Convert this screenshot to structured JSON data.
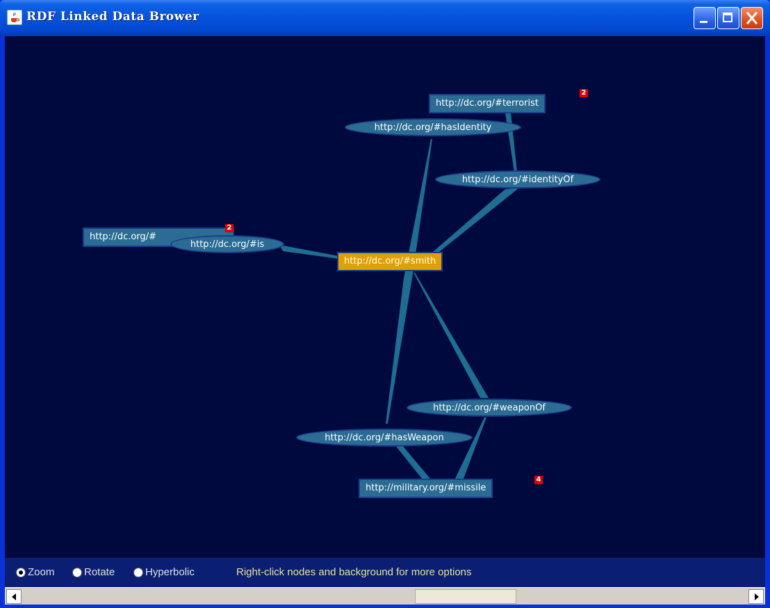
{
  "window": {
    "title": "RDF Linked Data Brower",
    "icons": {
      "app": "java-cup-icon",
      "minimize": "minimize-icon",
      "maximize": "maximize-icon",
      "close": "close-icon"
    }
  },
  "graph": {
    "nodes": {
      "terrorist": {
        "label": "http://dc.org/#terrorist",
        "badge": "2"
      },
      "hasIdentity": {
        "label": "http://dc.org/#hasIdentity"
      },
      "identityOf": {
        "label": "http://dc.org/#identityOf"
      },
      "left_rect": {
        "label": "http://dc.org/#",
        "badge": "2"
      },
      "is": {
        "label": "http://dc.org/#is"
      },
      "smith": {
        "label": "http://dc.org/#smith"
      },
      "weaponOf": {
        "label": "http://dc.org/#weaponOf"
      },
      "hasWeapon": {
        "label": "http://dc.org/#hasWeapon"
      },
      "missile": {
        "label": "http://military.org/#missile",
        "badge": "4"
      }
    },
    "colors": {
      "background": "#00093D",
      "node": "#2B6C94",
      "selected_node": "#E0A000",
      "edge": "#1E6E94",
      "badge": "#E00000"
    }
  },
  "controls": {
    "modes": [
      "Zoom",
      "Rotate",
      "Hyperbolic"
    ],
    "selected_mode": "Zoom",
    "hint": "Right-click nodes and background for more options"
  },
  "scrollbar": {
    "position": 0.52
  }
}
